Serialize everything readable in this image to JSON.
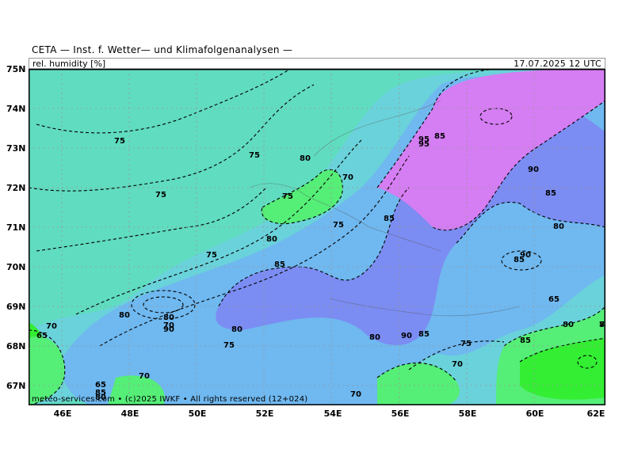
{
  "header": {
    "title": "CETA — Inst. f. Wetter— und Klimafolgenanalysen —",
    "parameter_label": "rel. humidity [%]",
    "valid_time": "17.07.2025 12 UTC"
  },
  "map": {
    "lat_labels": [
      "75N",
      "74N",
      "73N",
      "72N",
      "71N",
      "70N",
      "69N",
      "68N",
      "67N"
    ],
    "lon_labels": [
      "46E",
      "48E",
      "50E",
      "52E",
      "54E",
      "56E",
      "58E",
      "60E",
      "62E"
    ],
    "copyright": "meteo-services.com • (c)2025 IWKF • All rights reserved (12+024)",
    "contour_labels": [
      "75",
      "75",
      "75",
      "80",
      "70",
      "75",
      "75",
      "85",
      "95",
      "85",
      "95",
      "90",
      "85",
      "80",
      "90",
      "80",
      "85",
      "75",
      "80",
      "80",
      "70",
      "90",
      "80",
      "75",
      "80",
      "90",
      "85",
      "75",
      "70",
      "70",
      "65",
      "70",
      "65",
      "85",
      "80",
      "70",
      "85",
      "80",
      "80",
      "85",
      "65",
      "70"
    ],
    "colors": {
      "humidity_65": "#33ee33",
      "humidity_70": "#55ee77",
      "humidity_75": "#5ddcb8",
      "humidity_80": "#6ad2da",
      "humidity_85": "#6fb8f0",
      "humidity_90": "#7b8cf2",
      "humidity_95": "#d57df2"
    }
  }
}
